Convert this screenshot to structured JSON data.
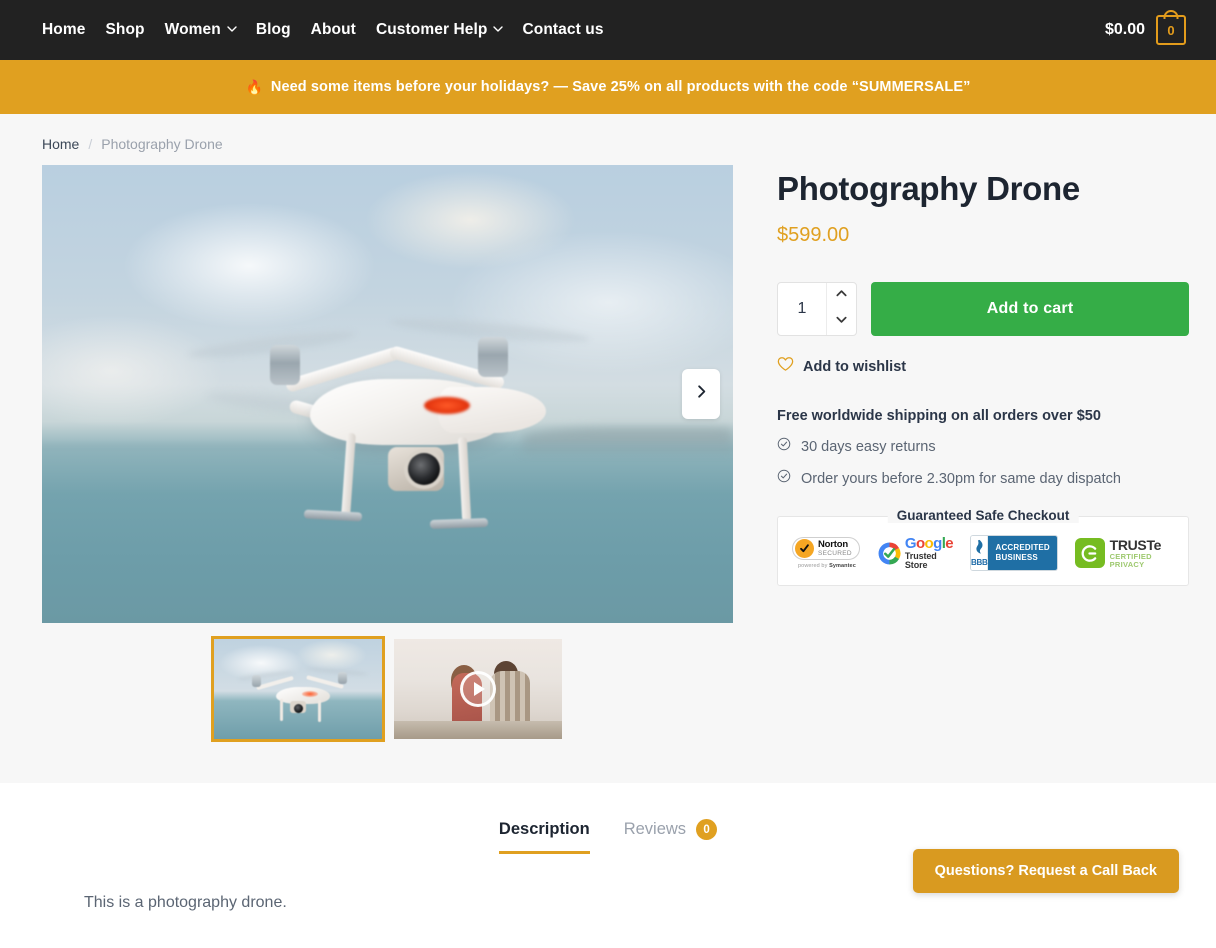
{
  "nav": {
    "items": [
      {
        "label": "Home",
        "has_dropdown": false
      },
      {
        "label": "Shop",
        "has_dropdown": false
      },
      {
        "label": "Women",
        "has_dropdown": true
      },
      {
        "label": "Blog",
        "has_dropdown": false
      },
      {
        "label": "About",
        "has_dropdown": false
      },
      {
        "label": "Customer Help",
        "has_dropdown": true
      },
      {
        "label": "Contact us",
        "has_dropdown": false
      }
    ],
    "cart": {
      "total": "$0.00",
      "count": "0",
      "icon": "shopping-bag-icon"
    }
  },
  "promo": {
    "emoji": "🔥",
    "text": "Need some items before your holidays? — Save 25% on all products with the code “SUMMERSALE”"
  },
  "breadcrumb": {
    "home": "Home",
    "separator": "/",
    "current": "Photography Drone"
  },
  "gallery": {
    "next_icon": "chevron-right-icon",
    "thumbnails": [
      {
        "name": "drone-photo-thumbnail",
        "type": "image",
        "active": true
      },
      {
        "name": "video-thumbnail",
        "type": "video",
        "active": false,
        "play_icon": "play-icon"
      }
    ]
  },
  "product": {
    "title": "Photography Drone",
    "price": "$599.00",
    "quantity": "1",
    "quantity_up_icon": "chevron-up-icon",
    "quantity_down_icon": "chevron-down-icon",
    "add_to_cart_label": "Add to cart",
    "wishlist_label": "Add to wishlist",
    "wishlist_icon": "heart-icon",
    "shipping_note": "Free worldwide shipping on all orders over $50",
    "features": [
      {
        "icon": "check-circle-icon",
        "label": "30 days easy returns"
      },
      {
        "icon": "check-circle-icon",
        "label": "Order yours before 2.30pm for same day dispatch"
      }
    ]
  },
  "safe_checkout": {
    "title": "Guaranteed Safe Checkout",
    "badges": [
      {
        "id": "norton-badge",
        "name": "Norton",
        "line2": "SECURED",
        "line3_prefix": "powered by ",
        "line3_brand": "Symantec"
      },
      {
        "id": "google-trusted-store-badge",
        "letters": [
          "G",
          "o",
          "o",
          "g",
          "l",
          "e"
        ],
        "subtitle": "Trusted Store"
      },
      {
        "id": "bbb-accredited-business-badge",
        "abbr": "BBB",
        "line1": "ACCREDITED",
        "line2": "BUSINESS"
      },
      {
        "id": "truste-badge",
        "name": "TRUSTe",
        "subtitle": "CERTIFIED PRIVACY"
      }
    ]
  },
  "tabs": {
    "items": [
      {
        "label": "Description",
        "active": true,
        "badge": null
      },
      {
        "label": "Reviews",
        "active": false,
        "badge": "0"
      }
    ],
    "description_text": "This is a photography drone."
  },
  "callback_button": {
    "label": "Questions? Request a Call Back"
  },
  "colors": {
    "nav_bg": "#222222",
    "promo_bg": "#e0a020",
    "accent_gold": "#e0a020",
    "add_to_cart_green": "#35ad47",
    "page_bg": "#f7f7f7",
    "callback_gold": "#d99a20"
  }
}
